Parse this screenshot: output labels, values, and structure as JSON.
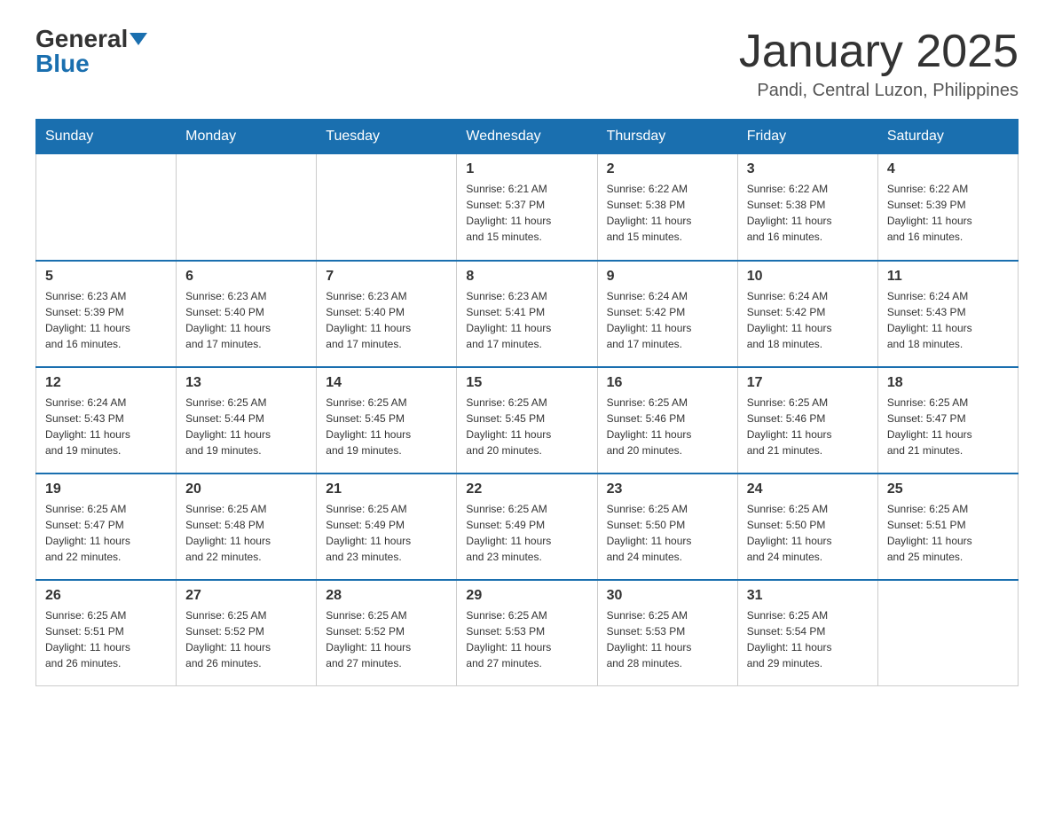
{
  "logo": {
    "general": "General",
    "blue": "Blue"
  },
  "title": "January 2025",
  "location": "Pandi, Central Luzon, Philippines",
  "headers": [
    "Sunday",
    "Monday",
    "Tuesday",
    "Wednesday",
    "Thursday",
    "Friday",
    "Saturday"
  ],
  "weeks": [
    [
      {
        "day": "",
        "info": ""
      },
      {
        "day": "",
        "info": ""
      },
      {
        "day": "",
        "info": ""
      },
      {
        "day": "1",
        "info": "Sunrise: 6:21 AM\nSunset: 5:37 PM\nDaylight: 11 hours\nand 15 minutes."
      },
      {
        "day": "2",
        "info": "Sunrise: 6:22 AM\nSunset: 5:38 PM\nDaylight: 11 hours\nand 15 minutes."
      },
      {
        "day": "3",
        "info": "Sunrise: 6:22 AM\nSunset: 5:38 PM\nDaylight: 11 hours\nand 16 minutes."
      },
      {
        "day": "4",
        "info": "Sunrise: 6:22 AM\nSunset: 5:39 PM\nDaylight: 11 hours\nand 16 minutes."
      }
    ],
    [
      {
        "day": "5",
        "info": "Sunrise: 6:23 AM\nSunset: 5:39 PM\nDaylight: 11 hours\nand 16 minutes."
      },
      {
        "day": "6",
        "info": "Sunrise: 6:23 AM\nSunset: 5:40 PM\nDaylight: 11 hours\nand 17 minutes."
      },
      {
        "day": "7",
        "info": "Sunrise: 6:23 AM\nSunset: 5:40 PM\nDaylight: 11 hours\nand 17 minutes."
      },
      {
        "day": "8",
        "info": "Sunrise: 6:23 AM\nSunset: 5:41 PM\nDaylight: 11 hours\nand 17 minutes."
      },
      {
        "day": "9",
        "info": "Sunrise: 6:24 AM\nSunset: 5:42 PM\nDaylight: 11 hours\nand 17 minutes."
      },
      {
        "day": "10",
        "info": "Sunrise: 6:24 AM\nSunset: 5:42 PM\nDaylight: 11 hours\nand 18 minutes."
      },
      {
        "day": "11",
        "info": "Sunrise: 6:24 AM\nSunset: 5:43 PM\nDaylight: 11 hours\nand 18 minutes."
      }
    ],
    [
      {
        "day": "12",
        "info": "Sunrise: 6:24 AM\nSunset: 5:43 PM\nDaylight: 11 hours\nand 19 minutes."
      },
      {
        "day": "13",
        "info": "Sunrise: 6:25 AM\nSunset: 5:44 PM\nDaylight: 11 hours\nand 19 minutes."
      },
      {
        "day": "14",
        "info": "Sunrise: 6:25 AM\nSunset: 5:45 PM\nDaylight: 11 hours\nand 19 minutes."
      },
      {
        "day": "15",
        "info": "Sunrise: 6:25 AM\nSunset: 5:45 PM\nDaylight: 11 hours\nand 20 minutes."
      },
      {
        "day": "16",
        "info": "Sunrise: 6:25 AM\nSunset: 5:46 PM\nDaylight: 11 hours\nand 20 minutes."
      },
      {
        "day": "17",
        "info": "Sunrise: 6:25 AM\nSunset: 5:46 PM\nDaylight: 11 hours\nand 21 minutes."
      },
      {
        "day": "18",
        "info": "Sunrise: 6:25 AM\nSunset: 5:47 PM\nDaylight: 11 hours\nand 21 minutes."
      }
    ],
    [
      {
        "day": "19",
        "info": "Sunrise: 6:25 AM\nSunset: 5:47 PM\nDaylight: 11 hours\nand 22 minutes."
      },
      {
        "day": "20",
        "info": "Sunrise: 6:25 AM\nSunset: 5:48 PM\nDaylight: 11 hours\nand 22 minutes."
      },
      {
        "day": "21",
        "info": "Sunrise: 6:25 AM\nSunset: 5:49 PM\nDaylight: 11 hours\nand 23 minutes."
      },
      {
        "day": "22",
        "info": "Sunrise: 6:25 AM\nSunset: 5:49 PM\nDaylight: 11 hours\nand 23 minutes."
      },
      {
        "day": "23",
        "info": "Sunrise: 6:25 AM\nSunset: 5:50 PM\nDaylight: 11 hours\nand 24 minutes."
      },
      {
        "day": "24",
        "info": "Sunrise: 6:25 AM\nSunset: 5:50 PM\nDaylight: 11 hours\nand 24 minutes."
      },
      {
        "day": "25",
        "info": "Sunrise: 6:25 AM\nSunset: 5:51 PM\nDaylight: 11 hours\nand 25 minutes."
      }
    ],
    [
      {
        "day": "26",
        "info": "Sunrise: 6:25 AM\nSunset: 5:51 PM\nDaylight: 11 hours\nand 26 minutes."
      },
      {
        "day": "27",
        "info": "Sunrise: 6:25 AM\nSunset: 5:52 PM\nDaylight: 11 hours\nand 26 minutes."
      },
      {
        "day": "28",
        "info": "Sunrise: 6:25 AM\nSunset: 5:52 PM\nDaylight: 11 hours\nand 27 minutes."
      },
      {
        "day": "29",
        "info": "Sunrise: 6:25 AM\nSunset: 5:53 PM\nDaylight: 11 hours\nand 27 minutes."
      },
      {
        "day": "30",
        "info": "Sunrise: 6:25 AM\nSunset: 5:53 PM\nDaylight: 11 hours\nand 28 minutes."
      },
      {
        "day": "31",
        "info": "Sunrise: 6:25 AM\nSunset: 5:54 PM\nDaylight: 11 hours\nand 29 minutes."
      },
      {
        "day": "",
        "info": ""
      }
    ]
  ]
}
